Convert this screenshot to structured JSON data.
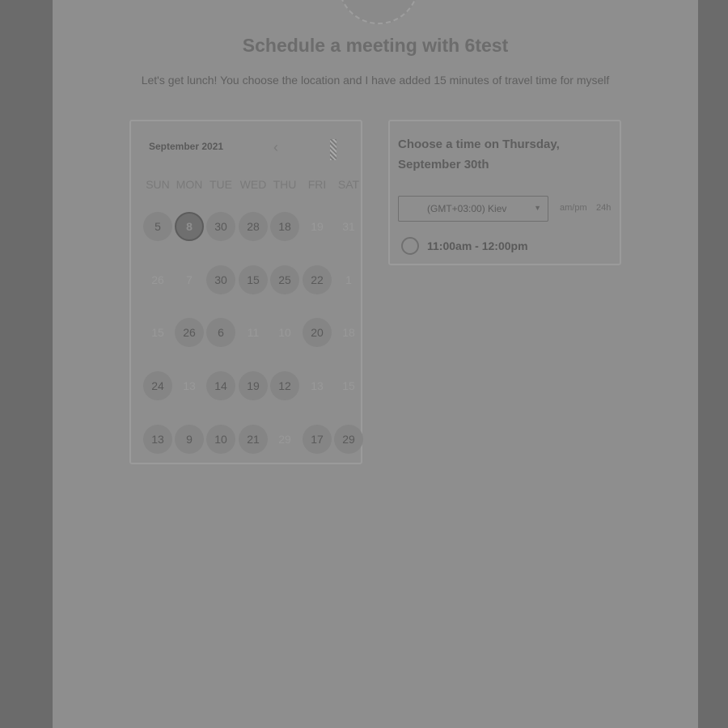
{
  "page": {
    "title": "Schedule a meeting with 6test",
    "subtitle": "Let's get lunch! You choose the location and I have added 15 minutes of travel time for myself"
  },
  "calendar": {
    "month_label": "September 2021",
    "weekdays": [
      "SUN",
      "MON",
      "TUE",
      "WED",
      "THU",
      "FRI",
      "SAT"
    ],
    "weeks": [
      [
        {
          "d": "5"
        },
        {
          "d": "8",
          "state": "selected"
        },
        {
          "d": "30"
        },
        {
          "d": "28"
        },
        {
          "d": "18"
        },
        {
          "d": "19",
          "state": "disabled"
        },
        {
          "d": "31",
          "state": "disabled"
        }
      ],
      [
        {
          "d": "26",
          "state": "disabled"
        },
        {
          "d": "7",
          "state": "disabled"
        },
        {
          "d": "30"
        },
        {
          "d": "15"
        },
        {
          "d": "25"
        },
        {
          "d": "22"
        },
        {
          "d": "1",
          "state": "disabled"
        }
      ],
      [
        {
          "d": "15",
          "state": "disabled"
        },
        {
          "d": "26"
        },
        {
          "d": "6"
        },
        {
          "d": "11",
          "state": "disabled"
        },
        {
          "d": "10",
          "state": "disabled"
        },
        {
          "d": "20"
        },
        {
          "d": "18",
          "state": "disabled"
        }
      ],
      [
        {
          "d": "24"
        },
        {
          "d": "13",
          "state": "disabled"
        },
        {
          "d": "14"
        },
        {
          "d": "19"
        },
        {
          "d": "12"
        },
        {
          "d": "13",
          "state": "disabled"
        },
        {
          "d": "15",
          "state": "disabled"
        }
      ],
      [
        {
          "d": "13"
        },
        {
          "d": "9"
        },
        {
          "d": "10"
        },
        {
          "d": "21"
        },
        {
          "d": "29",
          "state": "disabled"
        },
        {
          "d": "17"
        },
        {
          "d": "29"
        }
      ]
    ]
  },
  "timepicker": {
    "heading": "Choose a time on Thursday, September 30th",
    "timezone": "(GMT+03:00) Kiev",
    "format_12": "am/pm",
    "format_24": "24h",
    "slots": [
      "11:00am - 12:00pm"
    ]
  }
}
